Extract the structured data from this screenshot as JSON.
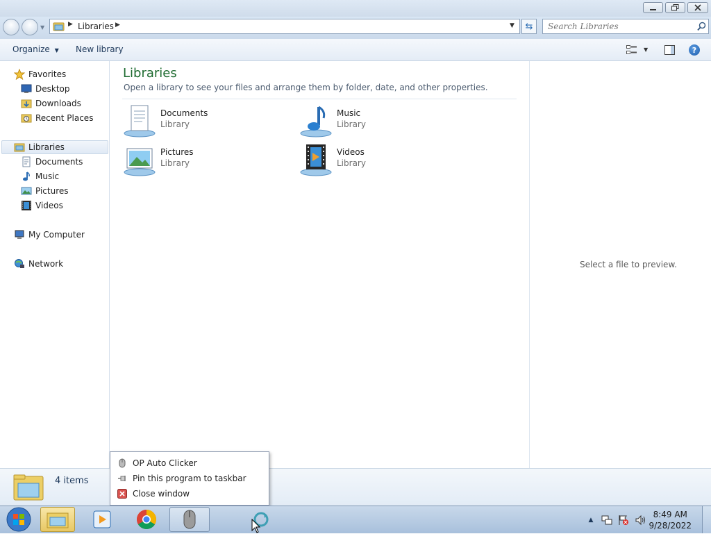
{
  "address": {
    "path": "Libraries"
  },
  "search": {
    "placeholder": "Search Libraries"
  },
  "toolbar": {
    "organize_label": "Organize",
    "new_library_label": "New library"
  },
  "nav": {
    "favorites": "Favorites",
    "desktop": "Desktop",
    "downloads": "Downloads",
    "recent_places": "Recent Places",
    "libraries": "Libraries",
    "documents": "Documents",
    "music": "Music",
    "pictures": "Pictures",
    "videos": "Videos",
    "my_computer": "My Computer",
    "network": "Network"
  },
  "content": {
    "title": "Libraries",
    "subtitle": "Open a library to see your files and arrange them by folder, date, and other properties.",
    "libraries": [
      {
        "name": "Documents",
        "kind": "Library",
        "icon": "documents-icon"
      },
      {
        "name": "Music",
        "kind": "Library",
        "icon": "music-icon"
      },
      {
        "name": "Pictures",
        "kind": "Library",
        "icon": "pictures-icon"
      },
      {
        "name": "Videos",
        "kind": "Library",
        "icon": "videos-icon"
      }
    ]
  },
  "preview": {
    "text": "Select a file to preview."
  },
  "details": {
    "items_count": "4 items"
  },
  "jumplist": {
    "items": [
      {
        "label": "OP Auto Clicker",
        "icon": "mouse-icon"
      },
      {
        "label": "Pin this program to taskbar",
        "icon": "pin-icon"
      },
      {
        "label": "Close window",
        "icon": "close-icon"
      }
    ]
  },
  "taskbar": {
    "time": "8:49 AM",
    "date": "9/28/2022"
  },
  "colors": {
    "title_green": "#1e6b30",
    "frame_blue": "#cbdaeb",
    "taskbar_blue": "#a8c0dc"
  }
}
